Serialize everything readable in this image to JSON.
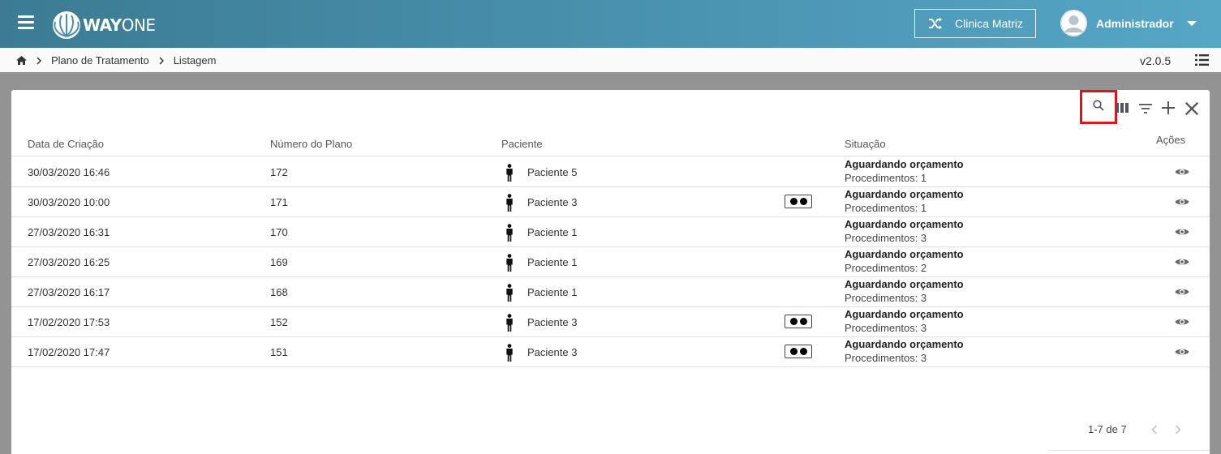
{
  "header": {
    "logo_text_bold": "WAY",
    "logo_text_light": "ONE",
    "clinic_label": "Clinica Matriz",
    "user_name": "Administrador"
  },
  "breadcrumb": {
    "items": [
      "Plano de Tratamento",
      "Listagem"
    ],
    "version": "v2.0.5"
  },
  "table": {
    "columns": {
      "date": "Data de Criação",
      "number": "Número do Plano",
      "patient": "Paciente",
      "status": "Situação",
      "actions": "Ações"
    },
    "rows": [
      {
        "date": "30/03/2020 16:46",
        "number": "172",
        "patient": "Paciente 5",
        "badge": false,
        "status": "Aguardando orçamento",
        "procedures": "Procedimentos: 1"
      },
      {
        "date": "30/03/2020 10:00",
        "number": "171",
        "patient": "Paciente 3",
        "badge": true,
        "status": "Aguardando orçamento",
        "procedures": "Procedimentos: 1"
      },
      {
        "date": "27/03/2020 16:31",
        "number": "170",
        "patient": "Paciente 1",
        "badge": false,
        "status": "Aguardando orçamento",
        "procedures": "Procedimentos: 3"
      },
      {
        "date": "27/03/2020 16:25",
        "number": "169",
        "patient": "Paciente 1",
        "badge": false,
        "status": "Aguardando orçamento",
        "procedures": "Procedimentos: 2"
      },
      {
        "date": "27/03/2020 16:17",
        "number": "168",
        "patient": "Paciente 1",
        "badge": false,
        "status": "Aguardando orçamento",
        "procedures": "Procedimentos: 3"
      },
      {
        "date": "17/02/2020 17:53",
        "number": "152",
        "patient": "Paciente 3",
        "badge": true,
        "status": "Aguardando orçamento",
        "procedures": "Procedimentos: 3"
      },
      {
        "date": "17/02/2020 17:47",
        "number": "151",
        "patient": "Paciente 3",
        "badge": true,
        "status": "Aguardando orçamento",
        "procedures": "Procedimentos: 3"
      }
    ]
  },
  "pagination": {
    "range": "1-7 de 7"
  },
  "icons": {
    "menu": "menu-icon",
    "shuffle": "shuffle-icon",
    "home": "home-icon",
    "list": "list-icon",
    "search": "search-icon",
    "columns": "columns-icon",
    "filter": "filter-icon",
    "add": "add-icon",
    "close": "close-icon",
    "person": "person-icon",
    "eye": "eye-icon"
  },
  "colors": {
    "header_start": "#3c7b93",
    "header_end": "#56a6c6",
    "highlight": "#e0131b"
  }
}
